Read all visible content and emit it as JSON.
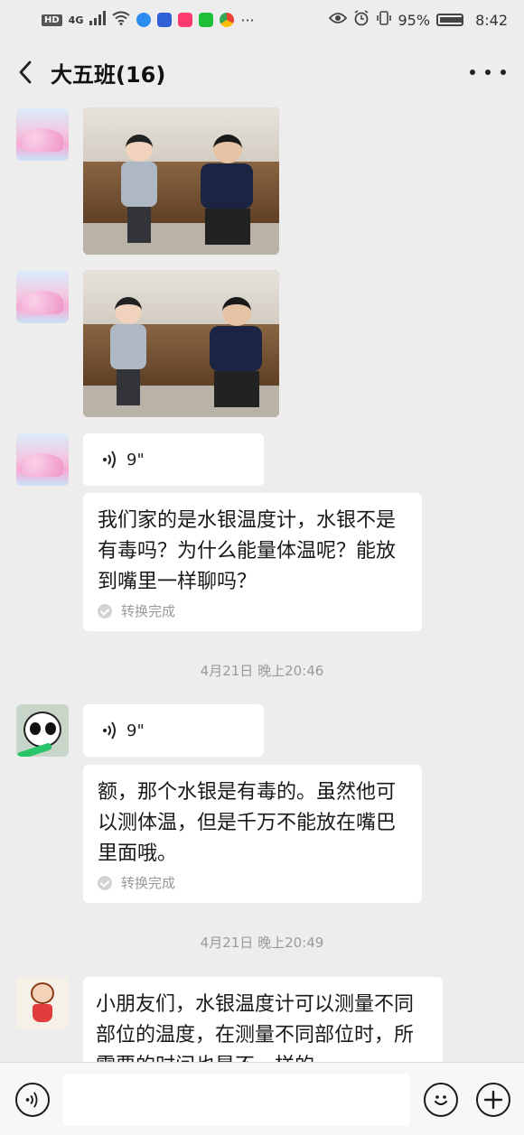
{
  "status_bar": {
    "network_badge": "HD",
    "network_type": "4G",
    "battery_percent": "95%",
    "time": "8:42",
    "more_indicator": "···"
  },
  "header": {
    "title": "大五班(16)"
  },
  "messages": {
    "voice_1": {
      "duration": "9\""
    },
    "trans_1": {
      "text": "我们家的是水银温度计，水银不是有毒吗？为什么能量体温呢？能放到嘴里一样聊吗？",
      "status": "转换完成"
    },
    "timestamp_1": "4月21日 晚上20:46",
    "voice_2": {
      "duration": "9\""
    },
    "trans_2": {
      "text": "额，那个水银是有毒的。虽然他可以测体温，但是千万不能放在嘴巴里面哦。",
      "status": "转换完成"
    },
    "timestamp_2": "4月21日 晚上20:49",
    "text_3": "小朋友们，水银温度计可以测量不同部位的温度，在测量不同部位时，所需要的时间也是不一样的。"
  },
  "input_bar": {
    "placeholder": ""
  }
}
